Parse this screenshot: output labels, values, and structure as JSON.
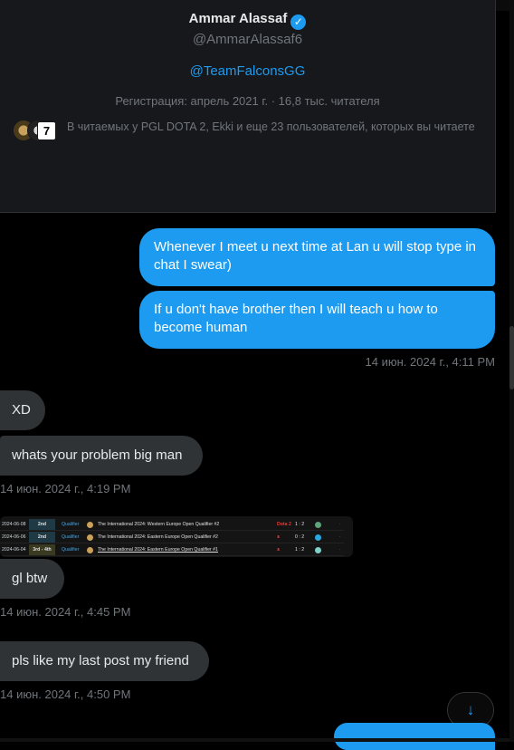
{
  "profile": {
    "name": "Ammar Alassaf",
    "verified_icon": "✓",
    "handle": "@AmmarAlassaf6",
    "bio_link": "@TeamFalconsGG",
    "registration": "Регистрация: апрель 2021 г. · 16,8 тыс. читателя",
    "followed_by": "В читаемых у PGL DOTA 2, Ekki и еще 23 пользователей, которых вы читаете",
    "followed_avatar_glyph": "7"
  },
  "messages": {
    "out1": "Whenever I meet u next time at Lan u will stop type in chat I swear)",
    "out2": "If u don't have brother then I will teach u how to become human",
    "out_time": "14 июн. 2024 г., 4:11 PM",
    "in1": "XD",
    "in2": "whats your problem big man",
    "in_time1": "14 июн. 2024 г., 4:19 PM",
    "in3": "gl btw",
    "in_time2": "14 июн. 2024 г., 4:45 PM",
    "in4": "pls like my last post my friend",
    "in_time3": "14 июн. 2024 г., 4:50 PM"
  },
  "media_table": {
    "rows": [
      {
        "date": "2024-06-08",
        "place": "2nd",
        "stage": "Qualifier",
        "title": "The International 2024: Western Europe Open Qualifier #2",
        "team_logo": "Dota 2",
        "score": "1 : 2"
      },
      {
        "date": "2024-06-06",
        "place": "2nd",
        "stage": "Qualifier",
        "title": "The International 2024: Eastern Europe Open Qualifier #2",
        "team_logo": "ᴥ",
        "score": "0 : 2"
      },
      {
        "date": "2024-06-04",
        "place": "3rd - 4th",
        "stage": "Qualifier",
        "title": "The International 2024: Eastern Europe Open Qualifier #1",
        "team_logo": "ᴥ",
        "score": "1 : 2"
      }
    ],
    "trailing": "·"
  },
  "scroll_button": {
    "icon": "↓"
  },
  "colors": {
    "accent": "#1d9bf0",
    "incoming_bubble": "#2f3336",
    "muted": "#71767b"
  }
}
